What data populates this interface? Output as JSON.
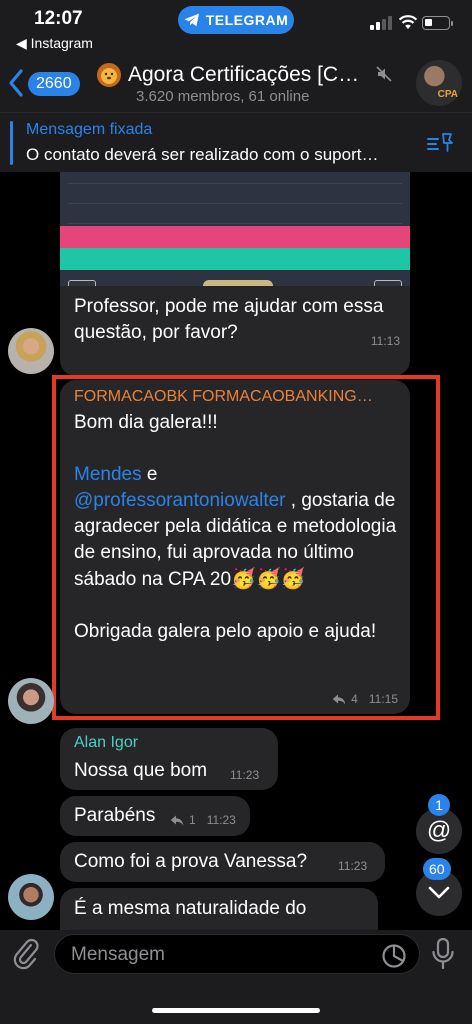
{
  "status_bar": {
    "time": "12:07",
    "back_app": "◀ Instagram",
    "telegram_pill": "TELEGRAM"
  },
  "header": {
    "unread_count": "2660",
    "title": "Agora Certificações [C…",
    "subtitle": "3.620 membros, 61 online"
  },
  "pinned": {
    "title": "Mensagem fixada",
    "text": "O contato deverá ser realizado com o suport…"
  },
  "messages": {
    "image_caption": "Professor, pode me ajudar com essa questão, por favor?",
    "image_time": "11:13",
    "main": {
      "sender": "FORMACAOBK FORMACAOBANKING…",
      "line1": "Bom dia galera!!!",
      "mention1": "Mendes",
      "connector": " e",
      "mention2": "@professorantoniowalter",
      "after_mention": " , gostaria de agradecer pela didática e metodologia de ensino, fui aprovada no último sábado na CPA 20",
      "emojis": "🥳🥳🥳",
      "closing": "Obrigada galera pelo apoio e ajuda!",
      "reply_count": "4",
      "time": "11:15"
    },
    "alan": {
      "name": "Alan Igor",
      "text": "Nossa que bom",
      "time": "11:23"
    },
    "parabens": {
      "text": "Parabéns",
      "reply_count": "1",
      "time": "11:23"
    },
    "como": {
      "text": "Como foi a prova Vanessa?",
      "time": "11:23"
    },
    "last": {
      "text": "É a mesma naturalidade do"
    }
  },
  "floating": {
    "mention_badge": "1",
    "down_badge": "60"
  },
  "input": {
    "placeholder": "Mensagem"
  },
  "colors": {
    "accent": "#2a83e8",
    "sender_orange": "#e8833a",
    "name_teal": "#4bd0c4",
    "highlight_red": "#e23a26",
    "bubble": "#262628"
  }
}
